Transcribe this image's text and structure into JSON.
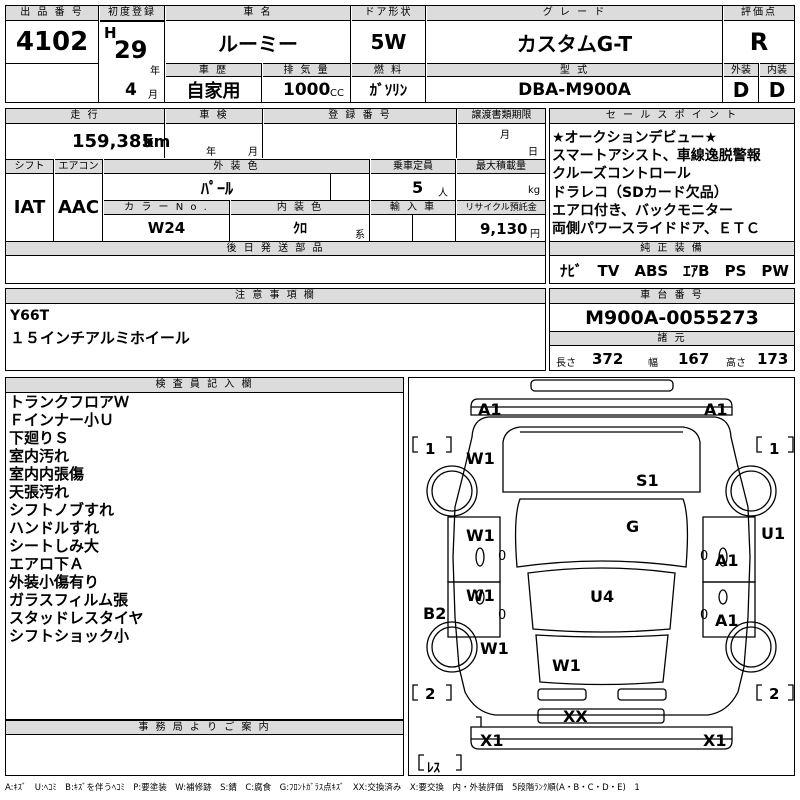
{
  "labels": {
    "lot_no": "出 品 番 号",
    "first_reg": "初度登録",
    "car_name": "車 名",
    "door": "ドア形状",
    "grade": "グ レ ー ド",
    "score": "評価点",
    "history": "車 歴",
    "displacement": "排 気 量",
    "fuel": "燃 料",
    "model_code": "型 式",
    "exterior": "外装",
    "interior": "内装",
    "mileage": "走 行",
    "inspection": "車 検",
    "reg_no": "登 録 番 号",
    "transfer_deadline": "譲渡書類期限",
    "sales_point": "セ ー ル ス ポ イ ン ト",
    "shift": "シフト",
    "aircon": "エアコン",
    "ext_color": "外 装 色",
    "capacity": "乗車定員",
    "max_load": "最大積載量",
    "color_no": "カ ラ ー N o .",
    "int_color": "内 装 色",
    "import": "輸 入 車",
    "recycle": "リサイクル預託金",
    "later_parts": "後 日 発 送 部 品",
    "genuine": "純 正 装 備",
    "notes": "注 意 事 項 欄",
    "chassis": "車 台 番 号",
    "dimensions": "諸 元",
    "inspector": "検 査 員 記 入 欄",
    "office": "事 務 局 よ り ご 案 内"
  },
  "units": {
    "year": "年",
    "month": "月",
    "cc": "CC",
    "km": "km",
    "person": "人",
    "kg": "kg",
    "kei": "系",
    "yen": "円",
    "length": "長さ",
    "width": "幅",
    "height": "高さ"
  },
  "values": {
    "lot_no": "4102",
    "era": "H",
    "year": "29",
    "month": "4",
    "car_name": "ルーミー",
    "door": "5W",
    "grade": "カスタムG-T",
    "score": "R",
    "history": "自家用",
    "displacement": "1000",
    "fuel": "ｶﾞｿﾘﾝ",
    "model_code": "DBA-M900A",
    "exterior": "D",
    "interior": "D",
    "mileage": "159,385",
    "shift": "IAT",
    "aircon": "AAC",
    "ext_color": "ﾊﾟｰﾙ",
    "capacity": "5",
    "color_no": "W24",
    "int_color": "ｸﾛ",
    "recycle": "9,130",
    "genuine": "ﾅﾋﾞ　TV　ABS　ｴｱB　PS　PW",
    "notes": [
      "Y66T",
      "１５インチアルミホイール"
    ],
    "chassis": "M900A-0055273",
    "length": "372",
    "width": "167",
    "height": "173"
  },
  "sales_points": [
    "★オークションデビュー★",
    "スマートアシスト、車線逸脱警報",
    "クルーズコントロール",
    "ドラレコ（SDカード欠品）",
    "エアロ付き、バックモニター",
    "両側パワースライドドア、ＥＴＣ"
  ],
  "inspector_notes": [
    "トランクフロアＷ",
    "Ｆインナー小Ｕ",
    "下廻りＳ",
    "室内汚れ",
    "室内内張傷",
    "天張汚れ",
    "シフトノブすれ",
    "ハンドルすれ",
    "シートしみ大",
    "エアロ下Ａ",
    "外装小傷有り",
    "ガラスフィルム張",
    "スタッドレスタイヤ",
    "シフトショック小"
  ],
  "diagram_marks": {
    "a1_front_left": "A1",
    "a1_front_right": "A1",
    "bracket_1_left": "[ 1 ]",
    "bracket_1_right": "[ 1 ]",
    "w1_fender": "W1",
    "s1_hood": "S1",
    "g_windshield": "G",
    "u1_right": "U1",
    "w1_front_door": "W1",
    "a1_right_front_door": "A1",
    "w1_rear_door": "W1",
    "u4_roof": "U4",
    "a1_right_rear_door": "A1",
    "b2_left": "B2",
    "w1_left_rear": "W1",
    "w1_trunk": "W1",
    "bracket_2_left": "[ 2 ]",
    "bracket_2_right": "[ 2 ]",
    "xx_rear": "XX",
    "x1_rear_left": "X1",
    "x1_rear_right": "X1",
    "less": "[ﾚｽ]",
    "zero1": "0",
    "zero2": "0",
    "zero3": "0",
    "zero4": "0"
  },
  "legend": "A:ｷｽﾞ　U:ﾍｺﾐ　B:ｷｽﾞを伴うﾍｺﾐ　P:要塗装　W:補修跡　S:錆　C:腐食　G:ﾌﾛﾝﾄｶﾞﾗｽ点ｷｽﾞ　XX:交換済み　X:要交換　内・外装評価　5段階ﾗﾝｸ順(A・B・C・D・E)　1"
}
